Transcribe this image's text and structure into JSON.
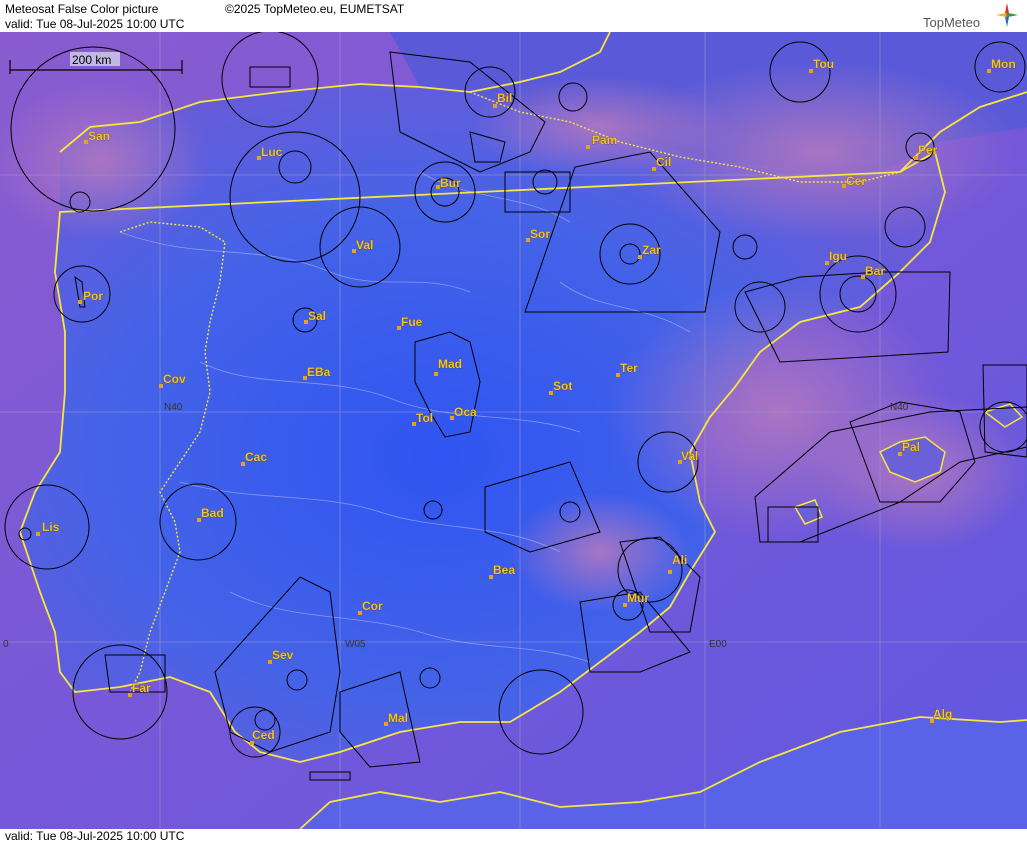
{
  "header": {
    "product_title": "Meteosat False Color picture",
    "copyright": "©2025 TopMeteo.eu, EUMETSAT",
    "valid_line": "valid:  Tue  08-Jul-2025  10:00 UTC",
    "logo_text": "TopMeteo"
  },
  "footer": {
    "valid_line": "valid:  Tue  08-Jul-2025  10:00 UTC"
  },
  "scale_bar": {
    "label": "200 km"
  },
  "grid_labels": {
    "n40": "N40",
    "w05": "W05",
    "e00": "E00",
    "zero": "0"
  },
  "colors": {
    "land_blue": "#3a5df0",
    "sea_purple": "#7a58d8",
    "cloud_pink": "#a070c8",
    "coast_yellow": "#f5e640",
    "city_label": "#f2c230",
    "airspace": "#000000"
  },
  "cities": [
    {
      "id": "san",
      "label": "San"
    },
    {
      "id": "luc",
      "label": "Luc"
    },
    {
      "id": "bur",
      "label": "Bur"
    },
    {
      "id": "bil",
      "label": "Bil"
    },
    {
      "id": "pam",
      "label": "Pam"
    },
    {
      "id": "cil",
      "label": "Cil"
    },
    {
      "id": "tou",
      "label": "Tou"
    },
    {
      "id": "mon",
      "label": "Mon"
    },
    {
      "id": "per",
      "label": "Per"
    },
    {
      "id": "cer",
      "label": "Cer"
    },
    {
      "id": "val-n",
      "label": "Val"
    },
    {
      "id": "sor",
      "label": "Sor"
    },
    {
      "id": "zar",
      "label": "Zar"
    },
    {
      "id": "igu",
      "label": "Igu"
    },
    {
      "id": "bar",
      "label": "Bar"
    },
    {
      "id": "por",
      "label": "Por"
    },
    {
      "id": "sal",
      "label": "Sal"
    },
    {
      "id": "fue",
      "label": "Fue"
    },
    {
      "id": "mad",
      "label": "Mad"
    },
    {
      "id": "cov",
      "label": "Cov"
    },
    {
      "id": "eba",
      "label": "EBa"
    },
    {
      "id": "sot",
      "label": "Sot"
    },
    {
      "id": "ter",
      "label": "Ter"
    },
    {
      "id": "tol",
      "label": "Tol"
    },
    {
      "id": "oca",
      "label": "Oca"
    },
    {
      "id": "cac",
      "label": "Cac"
    },
    {
      "id": "val-e",
      "label": "Val"
    },
    {
      "id": "pal",
      "label": "Pal"
    },
    {
      "id": "lis",
      "label": "Lis"
    },
    {
      "id": "bad",
      "label": "Bad"
    },
    {
      "id": "ali",
      "label": "Ali"
    },
    {
      "id": "bea",
      "label": "Bea"
    },
    {
      "id": "mur",
      "label": "Mur"
    },
    {
      "id": "cor",
      "label": "Cor"
    },
    {
      "id": "sev",
      "label": "Sev"
    },
    {
      "id": "far",
      "label": "Far"
    },
    {
      "id": "mal",
      "label": "Mal"
    },
    {
      "id": "ced",
      "label": "Ced"
    },
    {
      "id": "alg",
      "label": "Alg"
    }
  ]
}
